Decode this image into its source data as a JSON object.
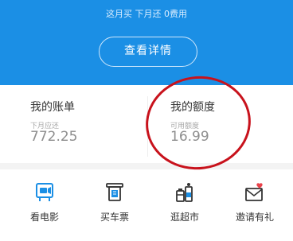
{
  "header": {
    "promo_text": "这月买 下月还 0费用",
    "detail_button": "查看详情"
  },
  "cards": {
    "bill": {
      "title": "我的账单",
      "subtitle": "下月应还",
      "amount": "772.25"
    },
    "limit": {
      "title": "我的额度",
      "subtitle": "可用额度",
      "amount": "16.99"
    }
  },
  "nav": [
    {
      "label": "看电影",
      "icon": "movie-ticket-icon"
    },
    {
      "label": "买车票",
      "icon": "train-ticket-icon"
    },
    {
      "label": "逛超市",
      "icon": "supermarket-icon"
    },
    {
      "label": "邀请有礼",
      "icon": "invite-mail-icon"
    }
  ],
  "colors": {
    "header_bg": "#1b8fe5",
    "icon_blue": "#1b8fe5",
    "annotation_red": "#c8121c"
  }
}
